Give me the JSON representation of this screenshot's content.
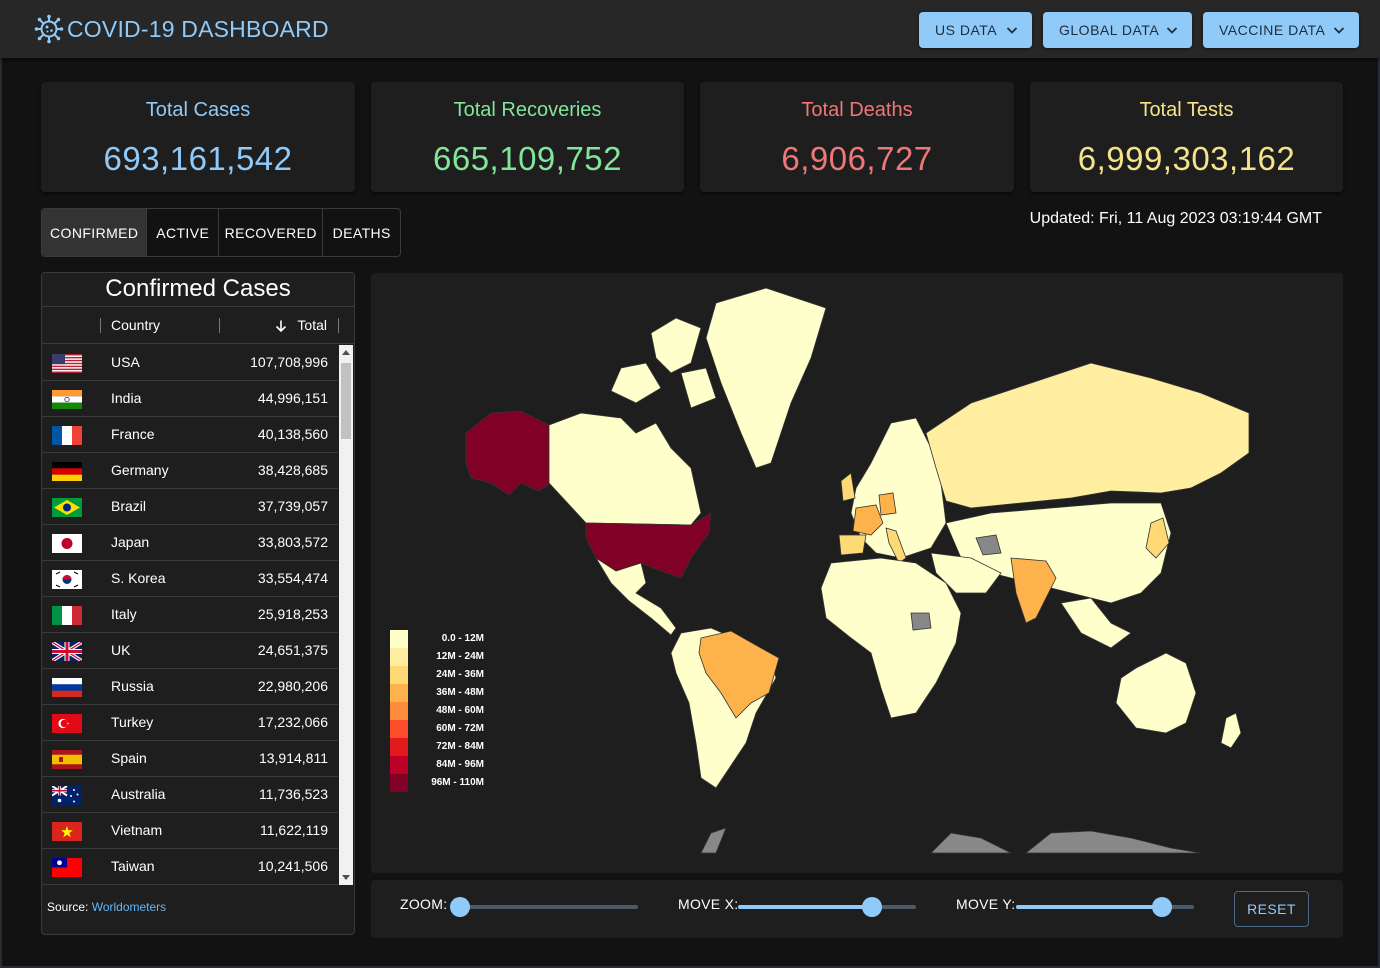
{
  "header": {
    "title": "COVID-19 DASHBOARD",
    "nav": [
      {
        "label": "US DATA"
      },
      {
        "label": "GLOBAL DATA"
      },
      {
        "label": "VACCINE DATA"
      }
    ]
  },
  "stats": [
    {
      "label": "Total Cases",
      "value": "693,161,542",
      "color": "#90caf9"
    },
    {
      "label": "Total Recoveries",
      "value": "665,109,752",
      "color": "#81e59a"
    },
    {
      "label": "Total Deaths",
      "value": "6,906,727",
      "color": "#ef7777"
    },
    {
      "label": "Total Tests",
      "value": "6,999,303,162",
      "color": "#f5e38a"
    }
  ],
  "toggles": [
    "CONFIRMED",
    "ACTIVE",
    "RECOVERED",
    "DEATHS"
  ],
  "selected_toggle": "CONFIRMED",
  "updated": "Updated: Fri, 11 Aug 2023 03:19:44 GMT",
  "table": {
    "title": "Confirmed Cases",
    "columns": {
      "country": "Country",
      "total": "Total"
    },
    "rows": [
      {
        "country": "USA",
        "total": "107,708,996",
        "flag": "us-flag"
      },
      {
        "country": "India",
        "total": "44,996,151",
        "flag": "india-flag"
      },
      {
        "country": "France",
        "total": "40,138,560",
        "flag": "france-flag"
      },
      {
        "country": "Germany",
        "total": "38,428,685",
        "flag": "germany-flag"
      },
      {
        "country": "Brazil",
        "total": "37,739,057",
        "flag": "brazil-flag"
      },
      {
        "country": "Japan",
        "total": "33,803,572",
        "flag": "japan-flag"
      },
      {
        "country": "S. Korea",
        "total": "33,554,474",
        "flag": "south-korea-flag"
      },
      {
        "country": "Italy",
        "total": "25,918,253",
        "flag": "italy-flag"
      },
      {
        "country": "UK",
        "total": "24,651,375",
        "flag": "uk-flag"
      },
      {
        "country": "Russia",
        "total": "22,980,206",
        "flag": "russia-flag"
      },
      {
        "country": "Turkey",
        "total": "17,232,066",
        "flag": "turkey-flag"
      },
      {
        "country": "Spain",
        "total": "13,914,811",
        "flag": "spain-flag"
      },
      {
        "country": "Australia",
        "total": "11,736,523",
        "flag": "australia-flag"
      },
      {
        "country": "Vietnam",
        "total": "11,622,119",
        "flag": "vietnam-flag"
      },
      {
        "country": "Taiwan",
        "total": "10,241,506",
        "flag": "taiwan-flag"
      }
    ],
    "source_prefix": "Source: ",
    "source_link": "Worldometers"
  },
  "legend": [
    {
      "label": "0.0 - 12M",
      "color": "#ffffcc"
    },
    {
      "label": "12M - 24M",
      "color": "#ffeda0"
    },
    {
      "label": "24M - 36M",
      "color": "#fed976"
    },
    {
      "label": "36M - 48M",
      "color": "#feb24c"
    },
    {
      "label": "48M - 60M",
      "color": "#fd8d3c"
    },
    {
      "label": "60M - 72M",
      "color": "#fc4e2a"
    },
    {
      "label": "72M - 84M",
      "color": "#e31a1c"
    },
    {
      "label": "84M - 96M",
      "color": "#bd0026"
    },
    {
      "label": "96M - 110M",
      "color": "#800026"
    }
  ],
  "controls": {
    "zoom_label": "ZOOM:",
    "movex_label": "MOVE X:",
    "movey_label": "MOVE Y:",
    "reset_label": "RESET",
    "zoom_value": 0,
    "movex_value": 0.75,
    "movey_value": 0.82
  },
  "colors": {
    "accent": "#90caf9",
    "usa": "#800026",
    "europe_mid": "#feb24c",
    "low": "#ffffcc",
    "unknown": "#888888"
  }
}
